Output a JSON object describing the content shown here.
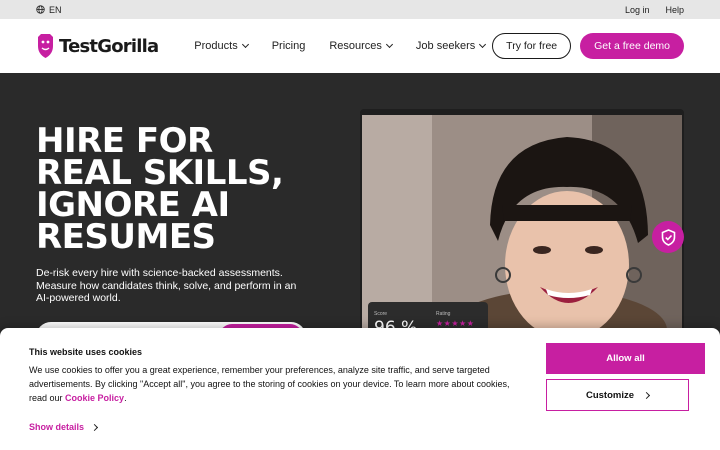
{
  "topbar": {
    "language": "EN",
    "login": "Log in",
    "help": "Help"
  },
  "nav": {
    "brand": "TestGorilla",
    "menu": [
      {
        "label": "Products",
        "has_dropdown": true
      },
      {
        "label": "Pricing",
        "has_dropdown": false
      },
      {
        "label": "Resources",
        "has_dropdown": true
      },
      {
        "label": "Job seekers",
        "has_dropdown": true
      }
    ],
    "try_free": "Try for free",
    "demo": "Get a free demo"
  },
  "hero": {
    "title_lines": [
      "HIRE FOR",
      "REAL SKILLS,",
      "IGNORE AI",
      "RESUMES"
    ],
    "subtitle": "De-risk every hire with science-backed assessments. Measure how candidates think, solve, and perform in an AI-powered world.",
    "score_label": "Score",
    "score_value": "96 %",
    "rating_label": "Rating",
    "rating_stars": "★★★★★"
  },
  "cookie": {
    "title": "This website uses cookies",
    "text": "We use cookies to offer you a great experience, remember your preferences, analyze site traffic, and serve targeted advertisements. By clicking \"Accept all\", you agree to the storing of cookies on your device. To learn more about cookies, read our",
    "policy_link": "Cookie Policy",
    "period": ".",
    "show_details": "Show details",
    "allow_all": "Allow all",
    "customize": "Customize"
  },
  "colors": {
    "accent": "#c71fa1",
    "hero_bg": "#2a2a2a",
    "topbar_bg": "#e6e6e6"
  },
  "icons": [
    "globe-icon",
    "gorilla-logo-icon",
    "chevron-down-icon",
    "shield-check-icon",
    "chevron-right-icon"
  ]
}
